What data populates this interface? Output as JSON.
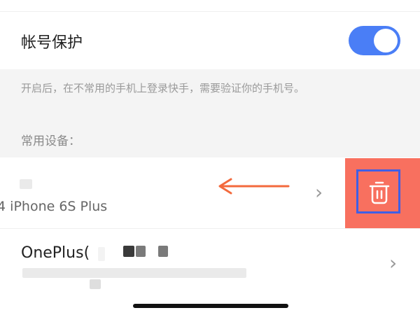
{
  "account_protection": {
    "label": "帐号保护",
    "enabled": true,
    "accent_color": "#4a7ef6",
    "hint": "开启后，在不常用的手机上登录快手，需要验证你的手机号。"
  },
  "devices": {
    "section_title": "常用设备：",
    "items": [
      {
        "name": ".4 iPhone 6S Plus",
        "swipe_hint_icon": "arrow-left-icon",
        "action_icon": "trash-icon",
        "action_color": "#f8705f"
      },
      {
        "name": "OnePlus("
      }
    ]
  }
}
